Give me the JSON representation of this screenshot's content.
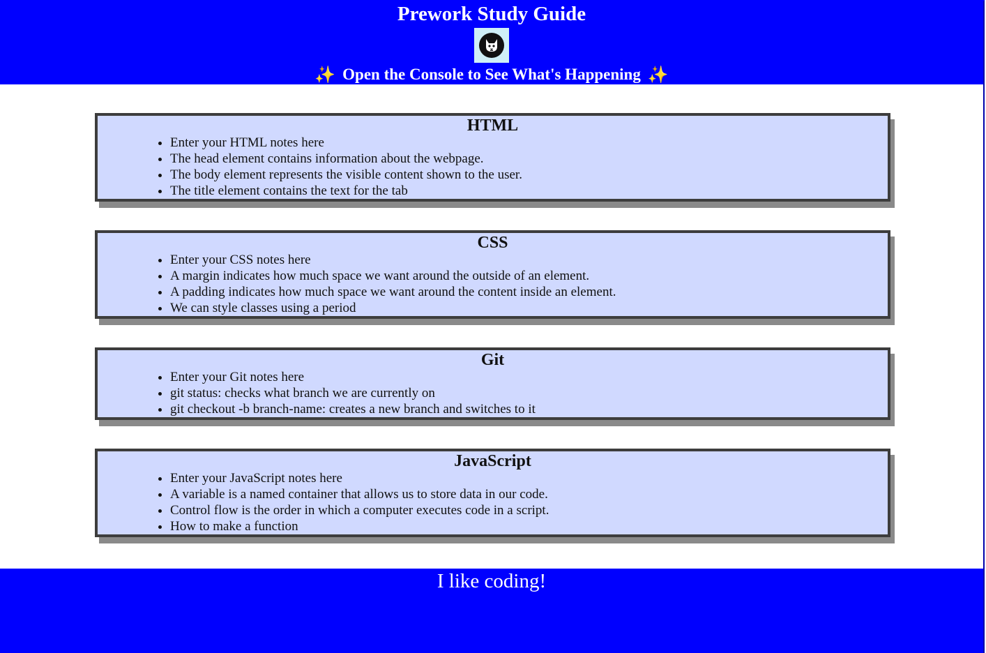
{
  "header": {
    "title": "Prework Study Guide",
    "logo_icon": "cat-icon",
    "subtitle": "Open the Console to See What's Happening",
    "sparkle_left": "✨",
    "sparkle_right": "✨",
    "background_color": "#0000ff",
    "text_color": "#ffffff"
  },
  "sections": [
    {
      "heading": "HTML",
      "items": [
        "Enter your HTML notes here",
        "The head element contains information about the webpage.",
        "The body element represents the visible content shown to the user.",
        "The title element contains the text for the tab"
      ]
    },
    {
      "heading": "CSS",
      "items": [
        "Enter your CSS notes here",
        "A margin indicates how much space we want around the outside of an element.",
        "A padding indicates how much space we want around the content inside an element.",
        "We can style classes using a period"
      ]
    },
    {
      "heading": "Git",
      "items": [
        "Enter your Git notes here",
        "git status: checks what branch we are currently on",
        "git checkout -b branch-name: creates a new branch and switches to it"
      ]
    },
    {
      "heading": "JavaScript",
      "items": [
        "Enter your JavaScript notes here",
        "A variable is a named container that allows us to store data in our code.",
        "Control flow is the order in which a computer executes code in a script.",
        "How to make a function"
      ]
    }
  ],
  "card_colors": {
    "background": "#d0d9ff",
    "border": "#3d3d3d",
    "shadow": "#8a8a8a"
  },
  "footer": {
    "text": "I like coding!"
  }
}
